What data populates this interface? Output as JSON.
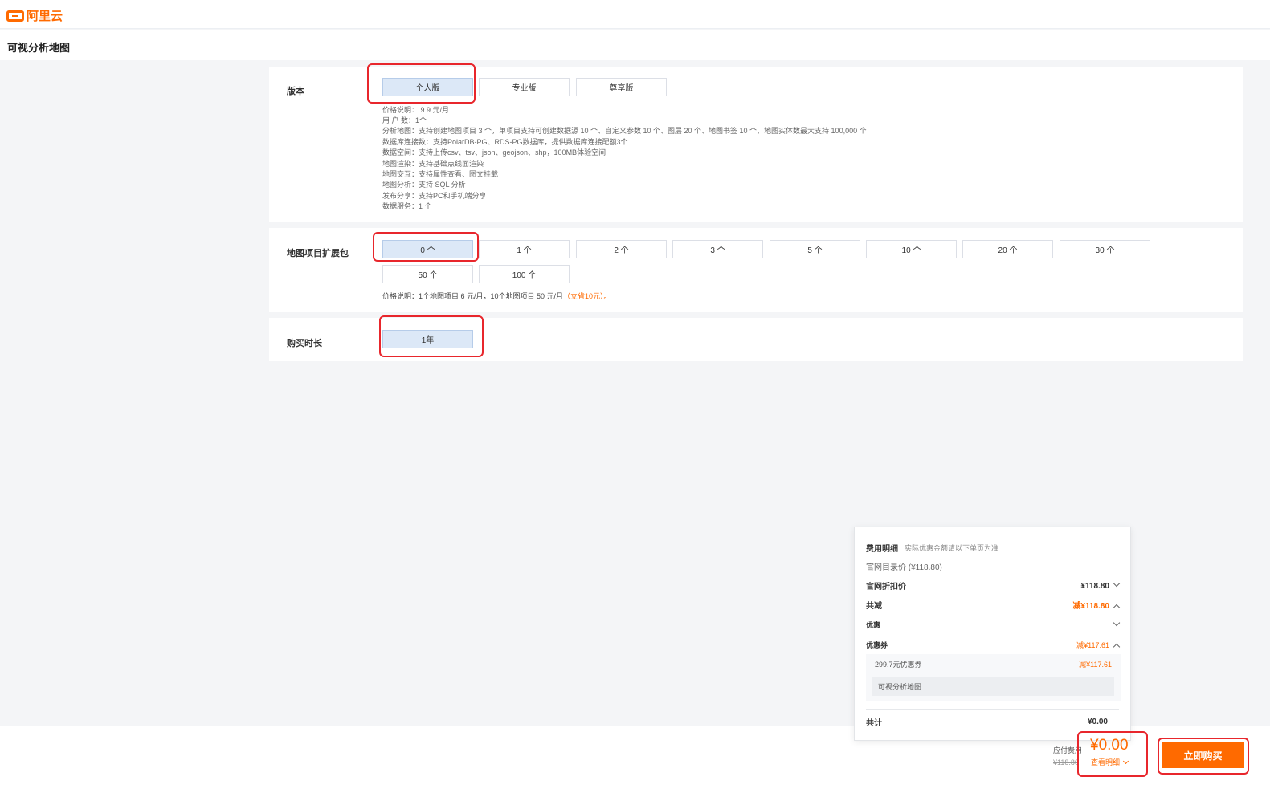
{
  "brand": {
    "name": "阿里云",
    "icon": "aliyun-logo-icon"
  },
  "page_title": "可视分析地图",
  "version": {
    "label": "版本",
    "options": [
      "个人版",
      "专业版",
      "尊享版"
    ],
    "selected": 0,
    "details": [
      "价格说明： 9.9 元/月",
      "用 户 数：1个",
      "分析地图：支持创建地图项目 3 个，单项目支持可创建数据源 10 个、自定义参数 10 个、图层 20 个、地图书签 10 个、地图实体数最大支持 100,000 个",
      "数据库连接数：支持PolarDB-PG、RDS-PG数据库，提供数据库连接配额3个",
      "数据空间：支持上传csv、tsv、json、geojson、shp，100MB体验空间",
      "地图渲染：支持基础点线面渲染",
      "地图交互：支持属性查看、图文挂载",
      "地图分析：支持 SQL 分析",
      "发布分享：支持PC和手机端分享",
      "数据服务：1 个"
    ]
  },
  "expansion": {
    "label": "地图项目扩展包",
    "options": [
      "0 个",
      "1 个",
      "2 个",
      "3 个",
      "5 个",
      "10 个",
      "20 个",
      "30 个",
      "50 个",
      "100 个"
    ],
    "selected": 0,
    "price_note": "价格说明：1个地图项目 6 元/月，10个地图项目 50 元/月",
    "price_highlight": "（立省10元）。"
  },
  "duration": {
    "label": "购买时长",
    "options": [
      "1年"
    ],
    "selected": 0
  },
  "fee": {
    "title": "费用明细",
    "subtitle": "实际优惠金额请以下单页为准",
    "list_price": "官网目录价 (¥118.80)",
    "discount_price_label": "官网折扣价",
    "discount_price_value": "¥118.80",
    "total_reduction_label": "共减",
    "total_reduction_value": "减¥118.80",
    "promo_label": "优惠",
    "coupon_label": "优惠券",
    "coupon_value": "减¥117.61",
    "coupon_item_name": "299.7元优惠券",
    "coupon_item_value": "减¥117.61",
    "coupon_item_product": "可视分析地图",
    "sum_label": "共计",
    "sum_value": "¥0.00"
  },
  "footer": {
    "payable_label": "应付费用",
    "original_price": "¥118.80",
    "price": "¥0.00",
    "view_detail": "查看明细",
    "buy_button": "立即购买"
  },
  "colors": {
    "accent": "#ff6a00",
    "selected_bg": "#dce8f7",
    "highlight": "#e8262c"
  }
}
